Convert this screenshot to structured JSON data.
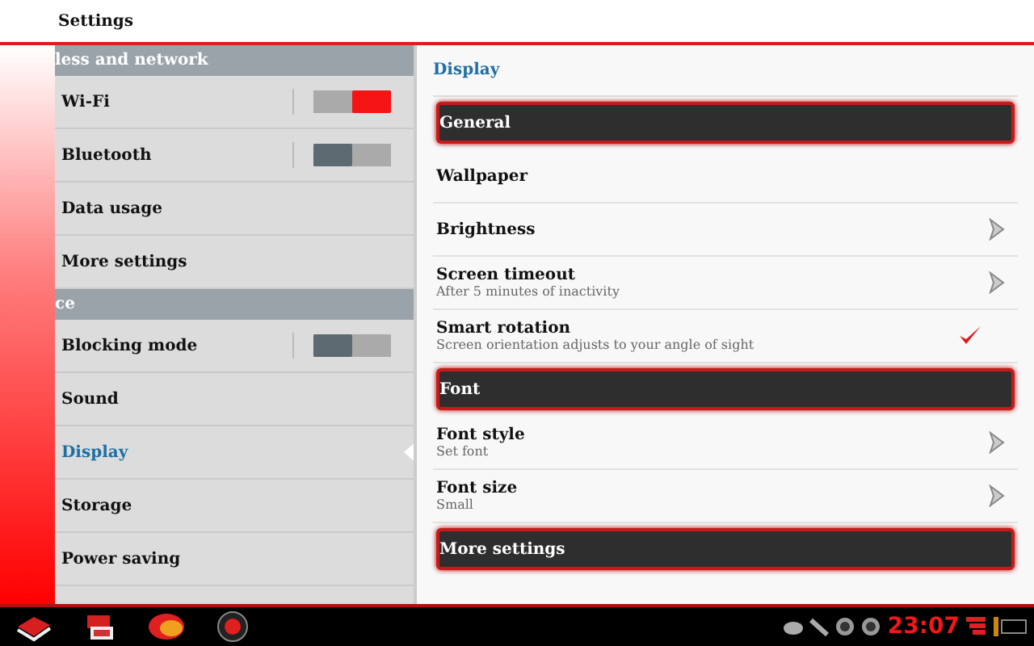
{
  "window": {
    "title": "Settings"
  },
  "sidebar": {
    "items": [
      {
        "kind": "header",
        "label": "less and network"
      },
      {
        "kind": "toggle",
        "label": "Wi-Fi",
        "on": true,
        "selected": false
      },
      {
        "kind": "toggle",
        "label": "Bluetooth",
        "on": false,
        "selected": false
      },
      {
        "kind": "item",
        "label": "Data usage",
        "selected": false
      },
      {
        "kind": "item",
        "label": "More settings",
        "selected": false
      },
      {
        "kind": "header",
        "label": "ce"
      },
      {
        "kind": "toggle",
        "label": "Blocking mode",
        "on": false,
        "selected": false
      },
      {
        "kind": "item",
        "label": "Sound",
        "selected": false
      },
      {
        "kind": "item",
        "label": "Display",
        "selected": true
      },
      {
        "kind": "item",
        "label": "Storage",
        "selected": false
      },
      {
        "kind": "item",
        "label": "Power saving",
        "selected": false
      }
    ]
  },
  "content": {
    "breadcrumb": "Display",
    "items": [
      {
        "kind": "header",
        "label": "General"
      },
      {
        "kind": "item",
        "label": "Wallpaper"
      },
      {
        "kind": "chevron",
        "label": "Brightness"
      },
      {
        "kind": "chevron",
        "label": "Screen timeout",
        "subtitle": "After 5 minutes of inactivity"
      },
      {
        "kind": "checkbox",
        "label": "Smart rotation",
        "subtitle": "Screen orientation adjusts to your angle of sight",
        "checked": true
      },
      {
        "kind": "header",
        "label": "Font"
      },
      {
        "kind": "chevron",
        "label": "Font style",
        "subtitle": "Set font"
      },
      {
        "kind": "chevron",
        "label": "Font size",
        "subtitle": "Small"
      },
      {
        "kind": "header",
        "label": "More settings"
      }
    ]
  },
  "status_bar": {
    "time": "23:07"
  }
}
